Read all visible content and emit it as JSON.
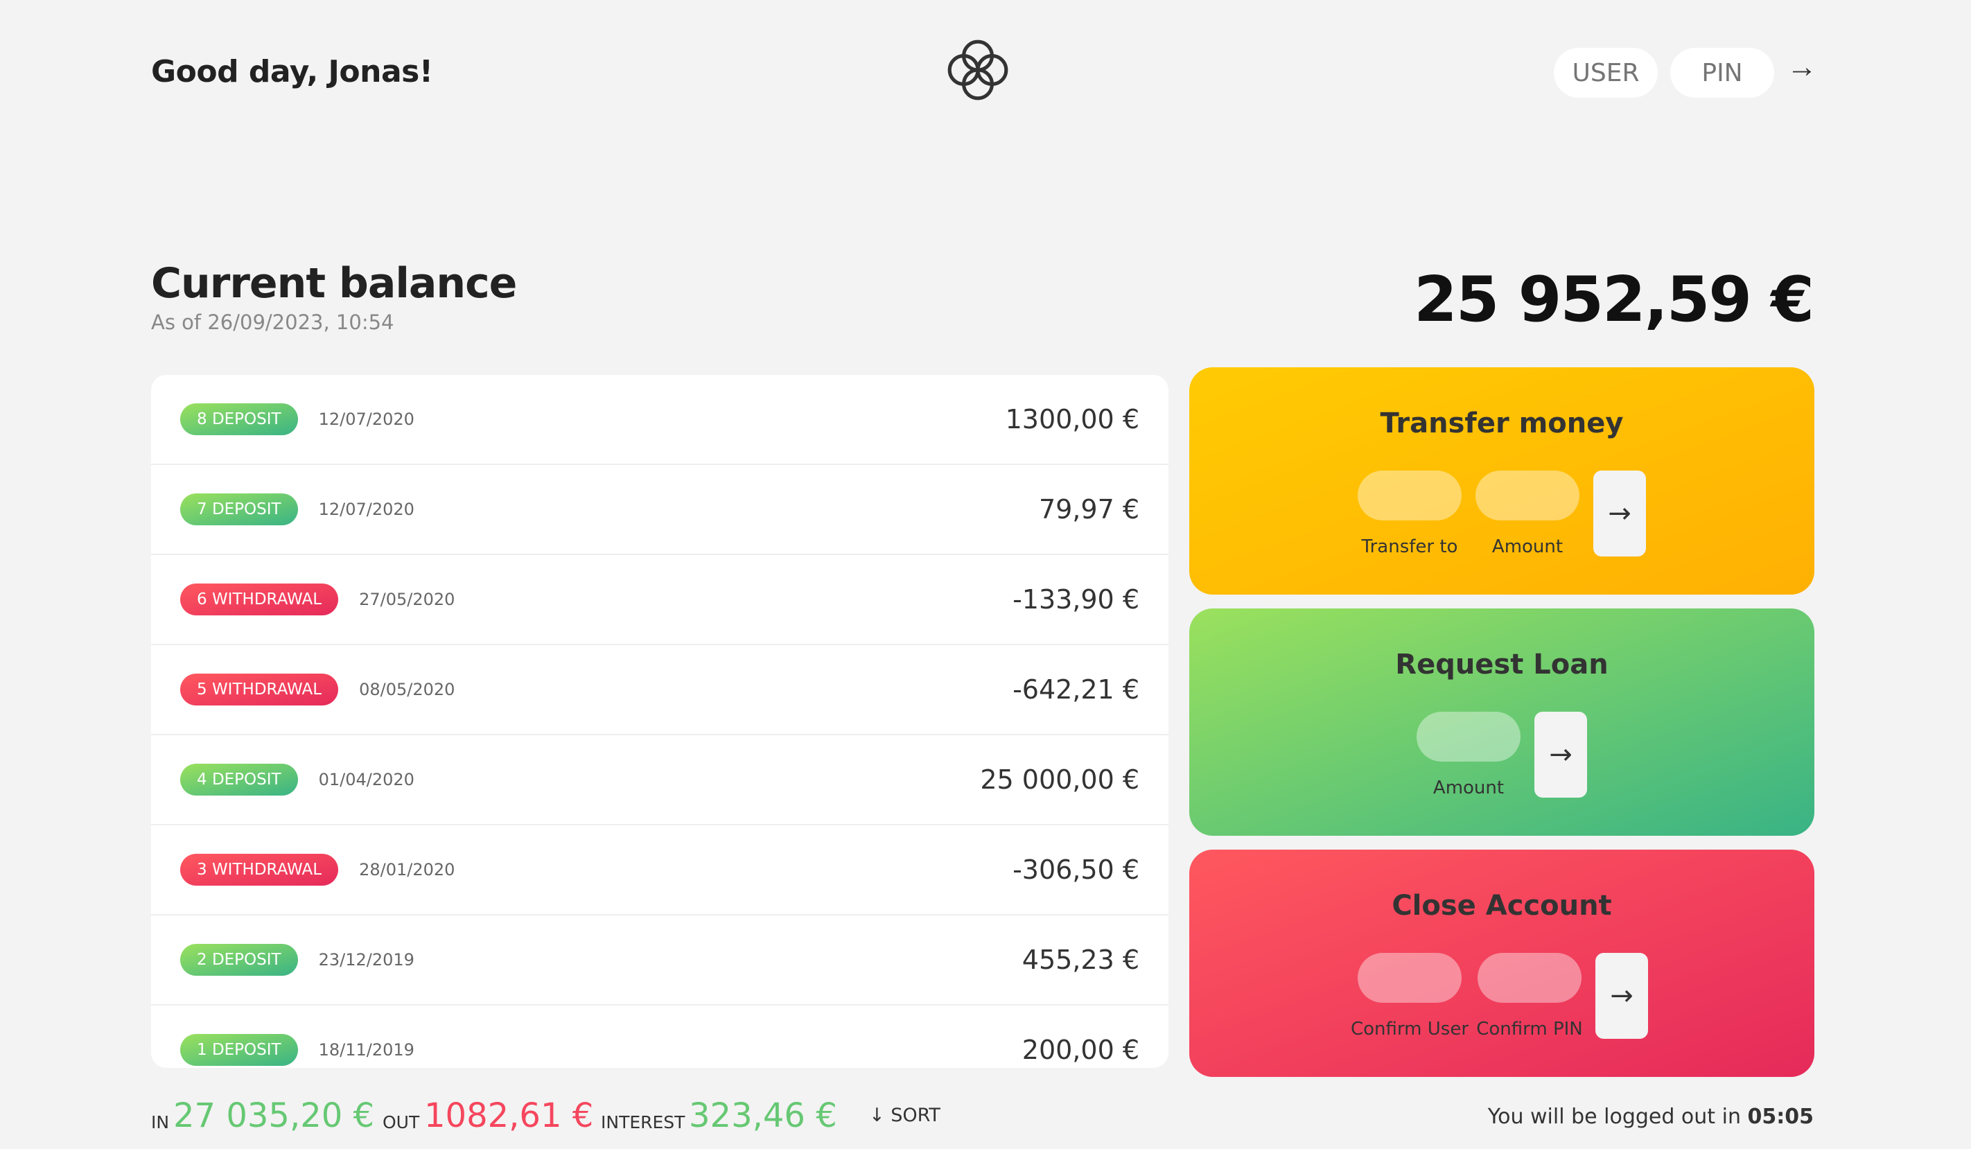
{
  "nav": {
    "welcome": "Good day, Jonas!",
    "user_placeholder": "USER",
    "pin_placeholder": "PIN",
    "login_button": "→"
  },
  "balance": {
    "label": "Current balance",
    "date": "As of 26/09/2023, 10:54",
    "value": "25 952,59 €"
  },
  "movements": [
    {
      "type": "8 DEPOSIT",
      "kind": "deposit",
      "date": "12/07/2020",
      "value": "1300,00 €"
    },
    {
      "type": "7 DEPOSIT",
      "kind": "deposit",
      "date": "12/07/2020",
      "value": "79,97 €"
    },
    {
      "type": "6 WITHDRAWAL",
      "kind": "withdrawal",
      "date": "27/05/2020",
      "value": "-133,90 €"
    },
    {
      "type": "5 WITHDRAWAL",
      "kind": "withdrawal",
      "date": "08/05/2020",
      "value": "-642,21 €"
    },
    {
      "type": "4 DEPOSIT",
      "kind": "deposit",
      "date": "01/04/2020",
      "value": "25 000,00 €"
    },
    {
      "type": "3 WITHDRAWAL",
      "kind": "withdrawal",
      "date": "28/01/2020",
      "value": "-306,50 €"
    },
    {
      "type": "2 DEPOSIT",
      "kind": "deposit",
      "date": "23/12/2019",
      "value": "455,23 €"
    },
    {
      "type": "1 DEPOSIT",
      "kind": "deposit",
      "date": "18/11/2019",
      "value": "200,00 €"
    }
  ],
  "operations": {
    "transfer": {
      "title": "Transfer money",
      "label_to": "Transfer to",
      "label_amount": "Amount",
      "button": "→"
    },
    "loan": {
      "title": "Request Loan",
      "label_amount": "Amount",
      "button": "→"
    },
    "close": {
      "title": "Close Account",
      "label_user": "Confirm User",
      "label_pin": "Confirm PIN",
      "button": "→"
    }
  },
  "summary": {
    "in_label": "In",
    "in_value": "27 035,20 €",
    "out_label": "Out",
    "out_value": "1082,61 €",
    "interest_label": "Interest",
    "interest_value": "323,46 €",
    "sort_label": "↓ SORT"
  },
  "logout": {
    "text": "You will be logged out in ",
    "timer": "05:05"
  },
  "colors": {
    "deposit": "#66c873",
    "withdrawal": "#f5465d",
    "transfer_bg": "#ffb003",
    "loan_bg": "#39b385",
    "close_bg": "#e52a5a"
  }
}
